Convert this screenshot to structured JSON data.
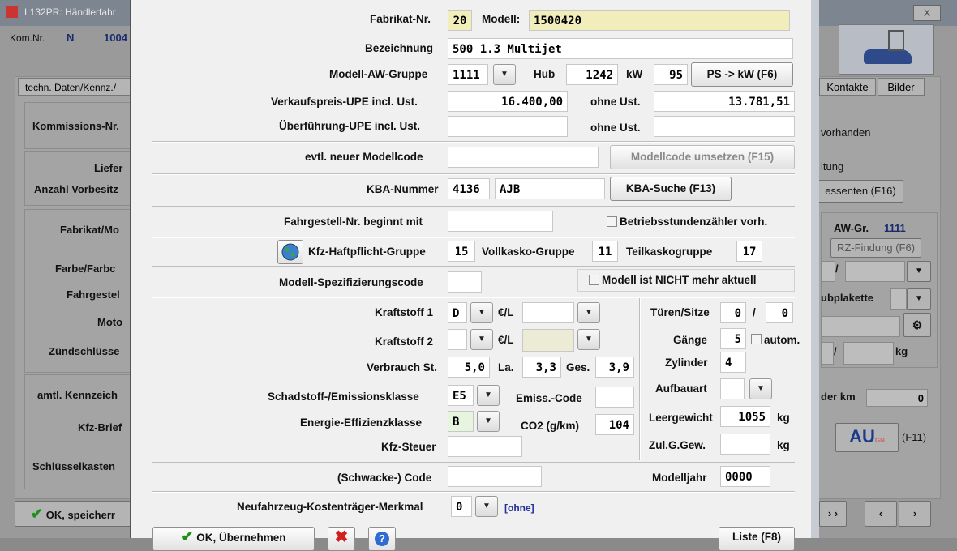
{
  "bg": {
    "title": "L132PR: Händlerfahr",
    "close": "X",
    "komnr_label": "Kom.Nr.",
    "komnr_n": "N",
    "komnr_val": "1004",
    "tab_techn": "techn. Daten/Kennz./",
    "tab_kontakte": "Kontakte",
    "tab_bilder": "Bilder",
    "kommissions": "Kommissions-Nr.",
    "liefer": "Liefer",
    "anzahl": "Anzahl Vorbesitz",
    "fabrikat": "Fabrikat/Mo",
    "farbe": "Farbe/Farbc",
    "fahrgestell": "Fahrgestel",
    "motor": "Moto",
    "zuend": "Zündschlüsse",
    "amtl": "amtl. Kennzeich",
    "kfzbrief": "Kfz-Brief",
    "schluessel": "Schlüsselkasten",
    "ok_save": "OK, speicherr",
    "vorhanden": "vorhanden",
    "tung": "ltung",
    "essenten": "essenten (F16)",
    "awgr_label": "AW-Gr.",
    "awgr_val": "1111",
    "rzfindung": "RZ-Findung (F6)",
    "slash1": "/",
    "ubplakette": "ubplakette",
    "slash2": "/",
    "kg": "kg",
    "der_km": "der km",
    "km_val": "0",
    "au": "AU",
    "au_sub": "GN",
    "f11": "(F11)",
    "nav_fwd": "› ›",
    "nav_prev": "‹",
    "nav_next": "›"
  },
  "dlg": {
    "fabrikat_nr_label": "Fabrikat-Nr.",
    "fabrikat_nr": "20",
    "modell_label": "Modell:",
    "modell": "1500420",
    "bezeichnung_label": "Bezeichnung",
    "bezeichnung": "500 1.3 Multijet",
    "aw_gruppe_label": "Modell-AW-Gruppe",
    "aw_gruppe": "1111",
    "hub_label": "Hub",
    "hub": "1242",
    "kw_label": "kW",
    "kw": "95",
    "ps_kw_btn": "PS -> kW (F6)",
    "vk_upe_label": "Verkaufspreis-UPE incl. Ust.",
    "vk_upe": "16.400,00",
    "ohne_ust_label": "ohne Ust.",
    "vk_ohne": "13.781,51",
    "ueberf_label": "Überführung-UPE incl. Ust.",
    "ueberf": "",
    "ohne_ust2_label": "ohne Ust.",
    "ueberf_ohne": "",
    "neuer_code_label": "evtl. neuer Modellcode",
    "neuer_code": "",
    "modellcode_btn": "Modellcode umsetzen (F15)",
    "kba_label": "KBA-Nummer",
    "kba1": "4136",
    "kba2": "AJB",
    "kba_btn": "KBA-Suche (F13)",
    "fahrg_label": "Fahrgestell-Nr. beginnt mit",
    "fahrg": "",
    "betriebs_label": "Betriebsstundenzähler vorh.",
    "kfz_haft_label": "Kfz-Haftpflicht-Gruppe",
    "kfz_haft": "15",
    "vollkasko_label": "Vollkasko-Gruppe",
    "vollkasko": "11",
    "teilkasko_label": "Teilkaskogruppe",
    "teilkasko": "17",
    "spez_label": "Modell-Spezifizierungscode",
    "spez": "",
    "nicht_aktuell_label": "Modell ist NICHT mehr aktuell",
    "kraft1_label": "Kraftstoff 1",
    "kraft1": "D",
    "eurl1": "€/L",
    "kraft1_price": "",
    "kraft2_label": "Kraftstoff 2",
    "kraft2": "",
    "eurl2": "€/L",
    "kraft2_price": "",
    "verbr_label": "Verbrauch St.",
    "verbr_st": "5,0",
    "la_label": "La.",
    "verbr_la": "3,3",
    "ges_label": "Ges.",
    "verbr_ges": "3,9",
    "schad_label": "Schadstoff-/Emissionsklasse",
    "schad": "E5",
    "emiss_label": "Emiss.-Code",
    "emiss": "",
    "energie_label": "Energie-Effizienzklasse",
    "energie": "B",
    "co2_label": "CO2 (g/km)",
    "co2": "104",
    "steuer_label": "Kfz-Steuer",
    "steuer": "",
    "tueren_label": "Türen/Sitze",
    "tueren": "0",
    "slash": "/",
    "sitze": "0",
    "gaenge_label": "Gänge",
    "gaenge": "5",
    "autom_label": "autom.",
    "zyl_label": "Zylinder",
    "zyl": "4",
    "aufbau_label": "Aufbauart",
    "aufbau": "",
    "leer_label": "Leergewicht",
    "leer": "1055",
    "kg1": "kg",
    "zulg_label": "Zul.G.Gew.",
    "zulg": "",
    "kg2": "kg",
    "schwacke_label": "(Schwacke-) Code",
    "schwacke": "",
    "modelljahr_label": "Modelljahr",
    "modelljahr": "0000",
    "neufz_label": "Neufahrzeug-Kostenträger-Merkmal",
    "neufz": "0",
    "ohne": "[ohne]",
    "ok_btn": "OK, Übernehmen",
    "liste_btn": "Liste (F8)"
  }
}
